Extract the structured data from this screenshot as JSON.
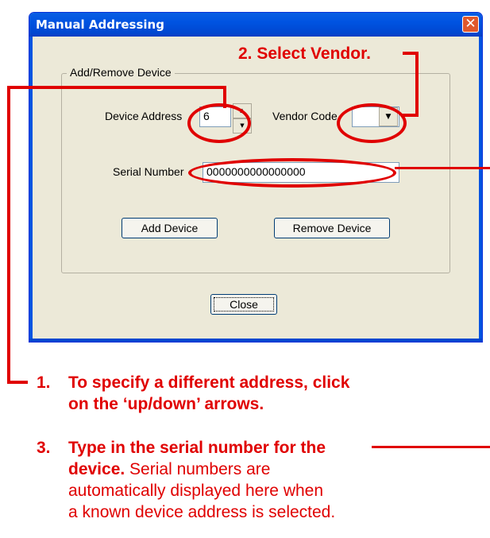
{
  "dialog": {
    "title": "Manual Addressing",
    "close_icon_label": "✕",
    "group_label": "Add/Remove Device",
    "device_address": {
      "label": "Device Address",
      "value": "6"
    },
    "vendor_code": {
      "label": "Vendor Code",
      "value": ""
    },
    "serial_number": {
      "label": "Serial Number",
      "value": "0000000000000000"
    },
    "buttons": {
      "add": "Add Device",
      "remove": "Remove Device",
      "close": "Close"
    }
  },
  "annotations": {
    "step2": "2. Select Vendor.",
    "step1_num": "1.",
    "step1_line1": "To specify a different address, click",
    "step1_line2": "on the ‘up/down’ arrows.",
    "step3_num": "3.",
    "step3_bold1": "Type in the serial number for the",
    "step3_bold2": "device.",
    "step3_text2": " Serial numbers are",
    "step3_text3": "automatically displayed here when",
    "step3_text4": "a known device address is selected.",
    "color": "#e00000"
  },
  "theme": {
    "title_bar": "#0053e1",
    "dialog_bg": "#ece9d8"
  }
}
